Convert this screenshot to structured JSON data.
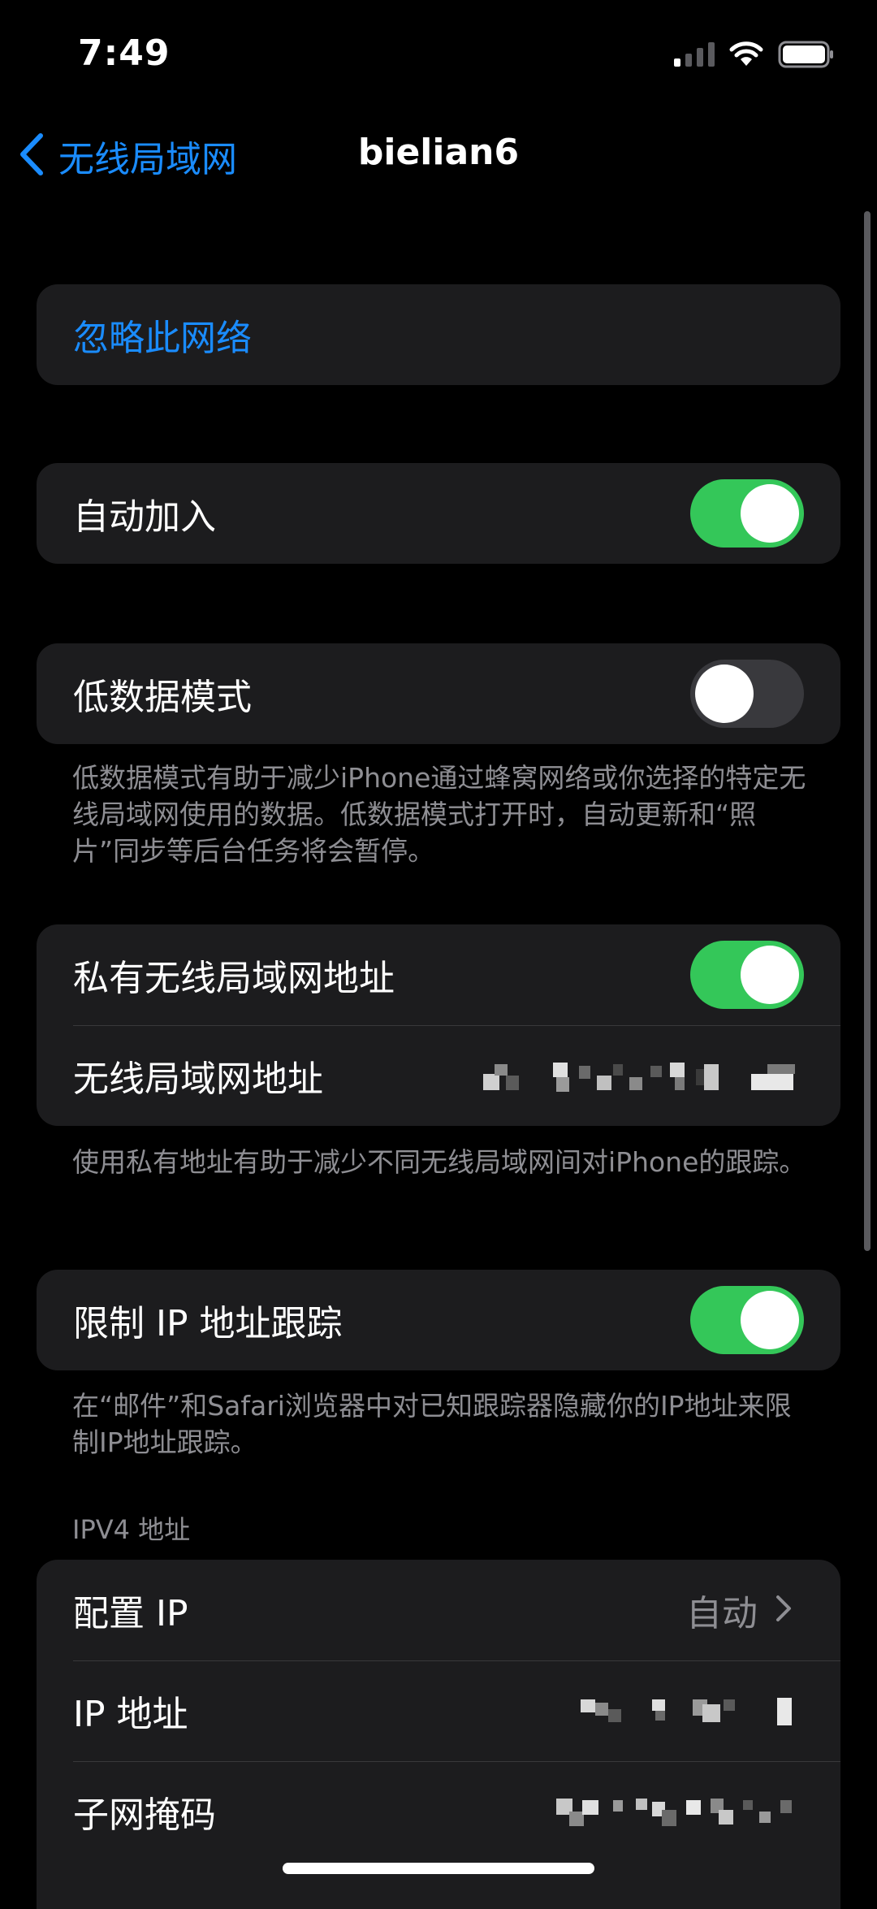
{
  "status_bar": {
    "time": "7:49",
    "signal_bars_active": 1
  },
  "nav": {
    "back_label": "无线局域网",
    "title": "bielian6"
  },
  "forget": {
    "label": "忽略此网络"
  },
  "auto_join": {
    "label": "自动加入",
    "on": true
  },
  "low_data": {
    "label": "低数据模式",
    "on": false,
    "footnote": "低数据模式有助于减少iPhone通过蜂窝网络或你选择的特定无线局域网使用的数据。低数据模式打开时，自动更新和“照片”同步等后台任务将会暂停。"
  },
  "private_address": {
    "label": "私有无线局域网地址",
    "on": true,
    "address_label": "无线局域网地址",
    "footnote": "使用私有地址有助于减少不同无线局域网间对iPhone的跟踪。"
  },
  "limit_ip": {
    "label": "限制 IP 地址跟踪",
    "on": true,
    "footnote": "在“邮件”和Safari浏览器中对已知跟踪器隐藏你的IP地址来限制IP地址跟踪。"
  },
  "ipv4": {
    "header": "IPV4 地址",
    "configure_label": "配置 IP",
    "configure_value": "自动",
    "ip_label": "IP 地址",
    "subnet_label": "子网掩码"
  },
  "colors": {
    "accent_blue": "#1a8cff",
    "toggle_on": "#34c759",
    "toggle_off": "#39393d",
    "cell_bg": "#1c1c1e",
    "secondary_text": "#8e8e93"
  },
  "icons": {
    "back": "chevron-left-icon",
    "disclosure": "chevron-right-icon",
    "wifi": "wifi-icon",
    "battery": "battery-icon",
    "signal": "cellular-signal-icon"
  }
}
